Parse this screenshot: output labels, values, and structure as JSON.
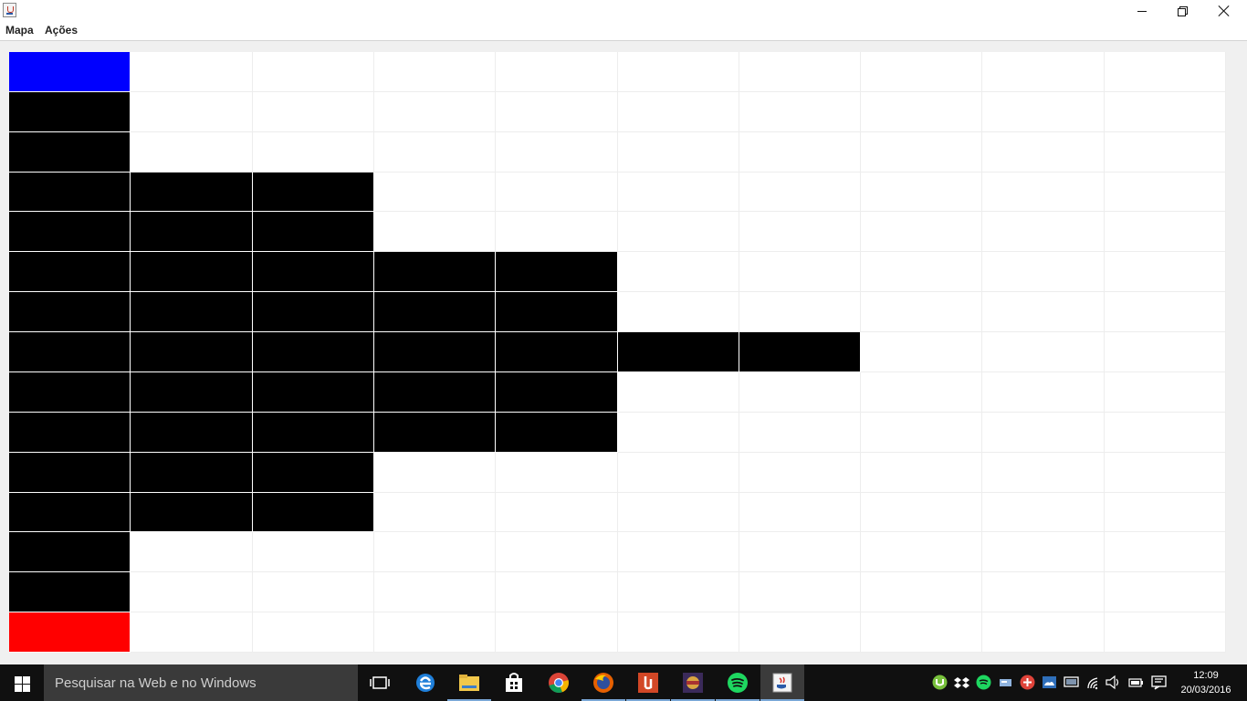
{
  "menu": {
    "items": [
      "Mapa",
      "Ações"
    ]
  },
  "grid": {
    "columns": 10,
    "rows": 15,
    "legend_colors": {
      "start": "#0000ff",
      "end": "#ff0000",
      "wall": "#000000",
      "empty": "#ffffff"
    },
    "cells": [
      "SEEEEEEEEE",
      "WEEEEEEEEE",
      "WEEEEEEEEE",
      "WWWEEEEEEE",
      "WWWEEEEEEE",
      "WWWWWEEEEE",
      "WWWWWEEEEE",
      "WWWWWWWEEE",
      "WWWWWEEEEE",
      "WWWWWEEEEE",
      "WWWEEEEEEE",
      "WWWEEEEEEE",
      "WEEEEEEEEE",
      "WEEEEEEEEE",
      "REEEEEEEEE"
    ]
  },
  "taskbar": {
    "search_placeholder": "Pesquisar na Web e no Windows",
    "apps": [
      "task-view",
      "edge",
      "file-explorer",
      "store",
      "chrome",
      "firefox",
      "office-app",
      "game-app",
      "spotify",
      "java"
    ],
    "tray_icons": [
      "utorrent",
      "dropbox",
      "spotify",
      "network-drive",
      "antivirus",
      "onedrive",
      "display",
      "wifi",
      "volume",
      "battery",
      "notifications"
    ],
    "time": "12:09",
    "date": "20/03/2016"
  }
}
